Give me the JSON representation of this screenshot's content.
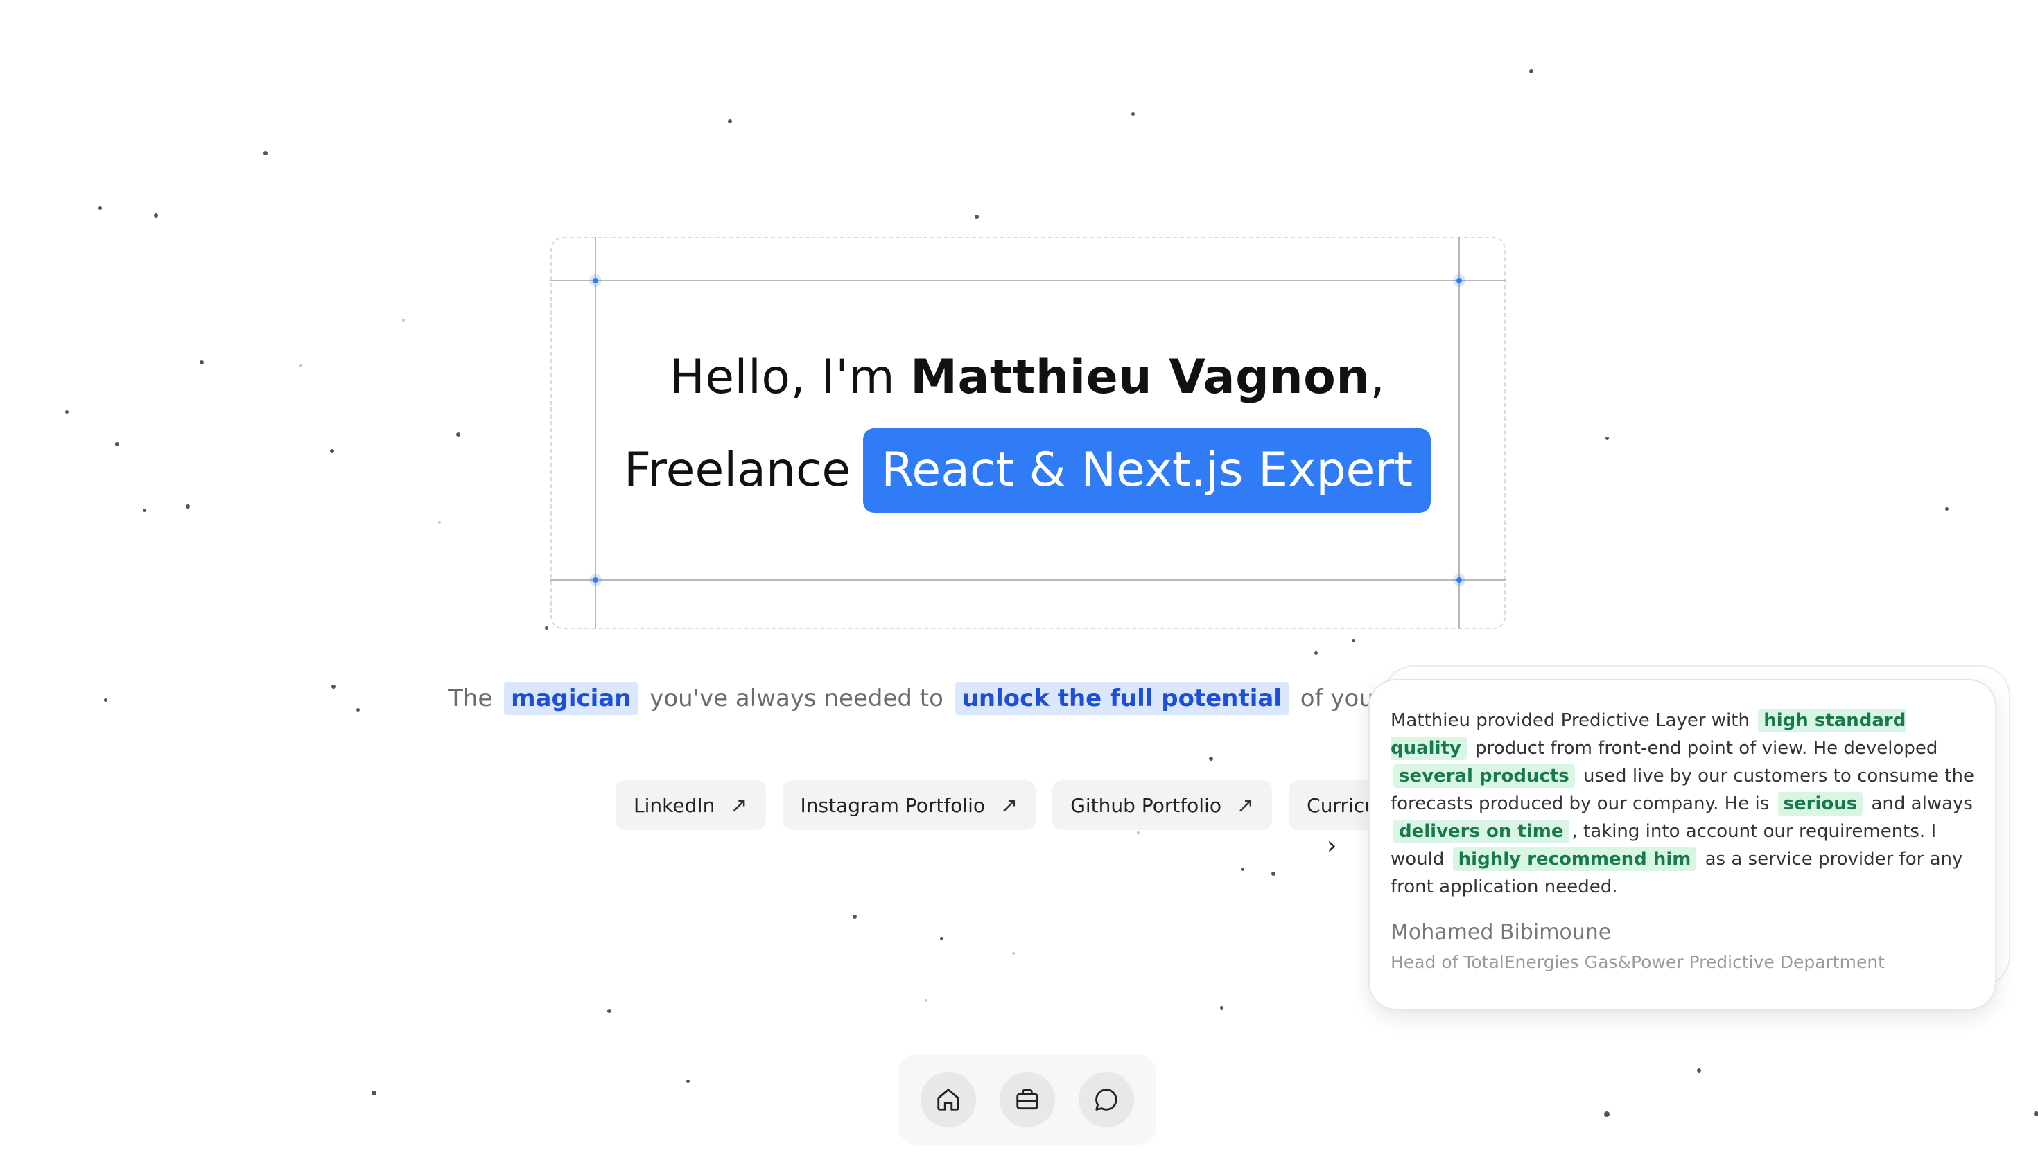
{
  "hero": {
    "greeting": "Hello, I'm ",
    "name": "Matthieu Vagnon",
    "comma": ",",
    "role_prefix": "Freelance",
    "role_highlight": "React & Next.js Expert"
  },
  "tagline": {
    "part1": "The",
    "highlight1": "magician",
    "part2": "you've always needed to",
    "highlight2": "unlock the full potential",
    "part3": "of your SaaS or web app"
  },
  "links": [
    {
      "label": "LinkedIn",
      "icon": "arrow-up-right-icon"
    },
    {
      "label": "Instagram Portfolio",
      "icon": "arrow-up-right-icon"
    },
    {
      "label": "Github Portfolio",
      "icon": "arrow-up-right-icon"
    },
    {
      "label": "Curriculum Vit"
    }
  ],
  "chevron_icon": "chevron-right-icon",
  "testimonial": {
    "t1": "Matthieu provided Predictive Layer with",
    "h1": "high standard quality",
    "t2": "product from front-end point of view. He developed",
    "h2": "several products",
    "t3": "used live by our customers to consume the forecasts produced by our company. He is",
    "h3": "serious",
    "t4": "and always",
    "h4": "delivers on time",
    "t5": ", taking into account our requirements. I would",
    "h5": "highly recommend him",
    "t6": "as a service provider for any front application needed.",
    "author": "Mohamed Bibimoune",
    "role": "Head of TotalEnergies Gas&Power Predictive Department"
  },
  "dock": [
    {
      "icon": "home-icon"
    },
    {
      "icon": "briefcase-icon"
    },
    {
      "icon": "chat-bubble-icon"
    }
  ],
  "colors": {
    "accent": "#2f7cf6",
    "tagline_highlight_bg": "#dbe7fc",
    "tagline_highlight_text": "#1d4ed8",
    "quote_highlight_bg": "#d9f5e3",
    "quote_highlight_text": "#18794e"
  }
}
